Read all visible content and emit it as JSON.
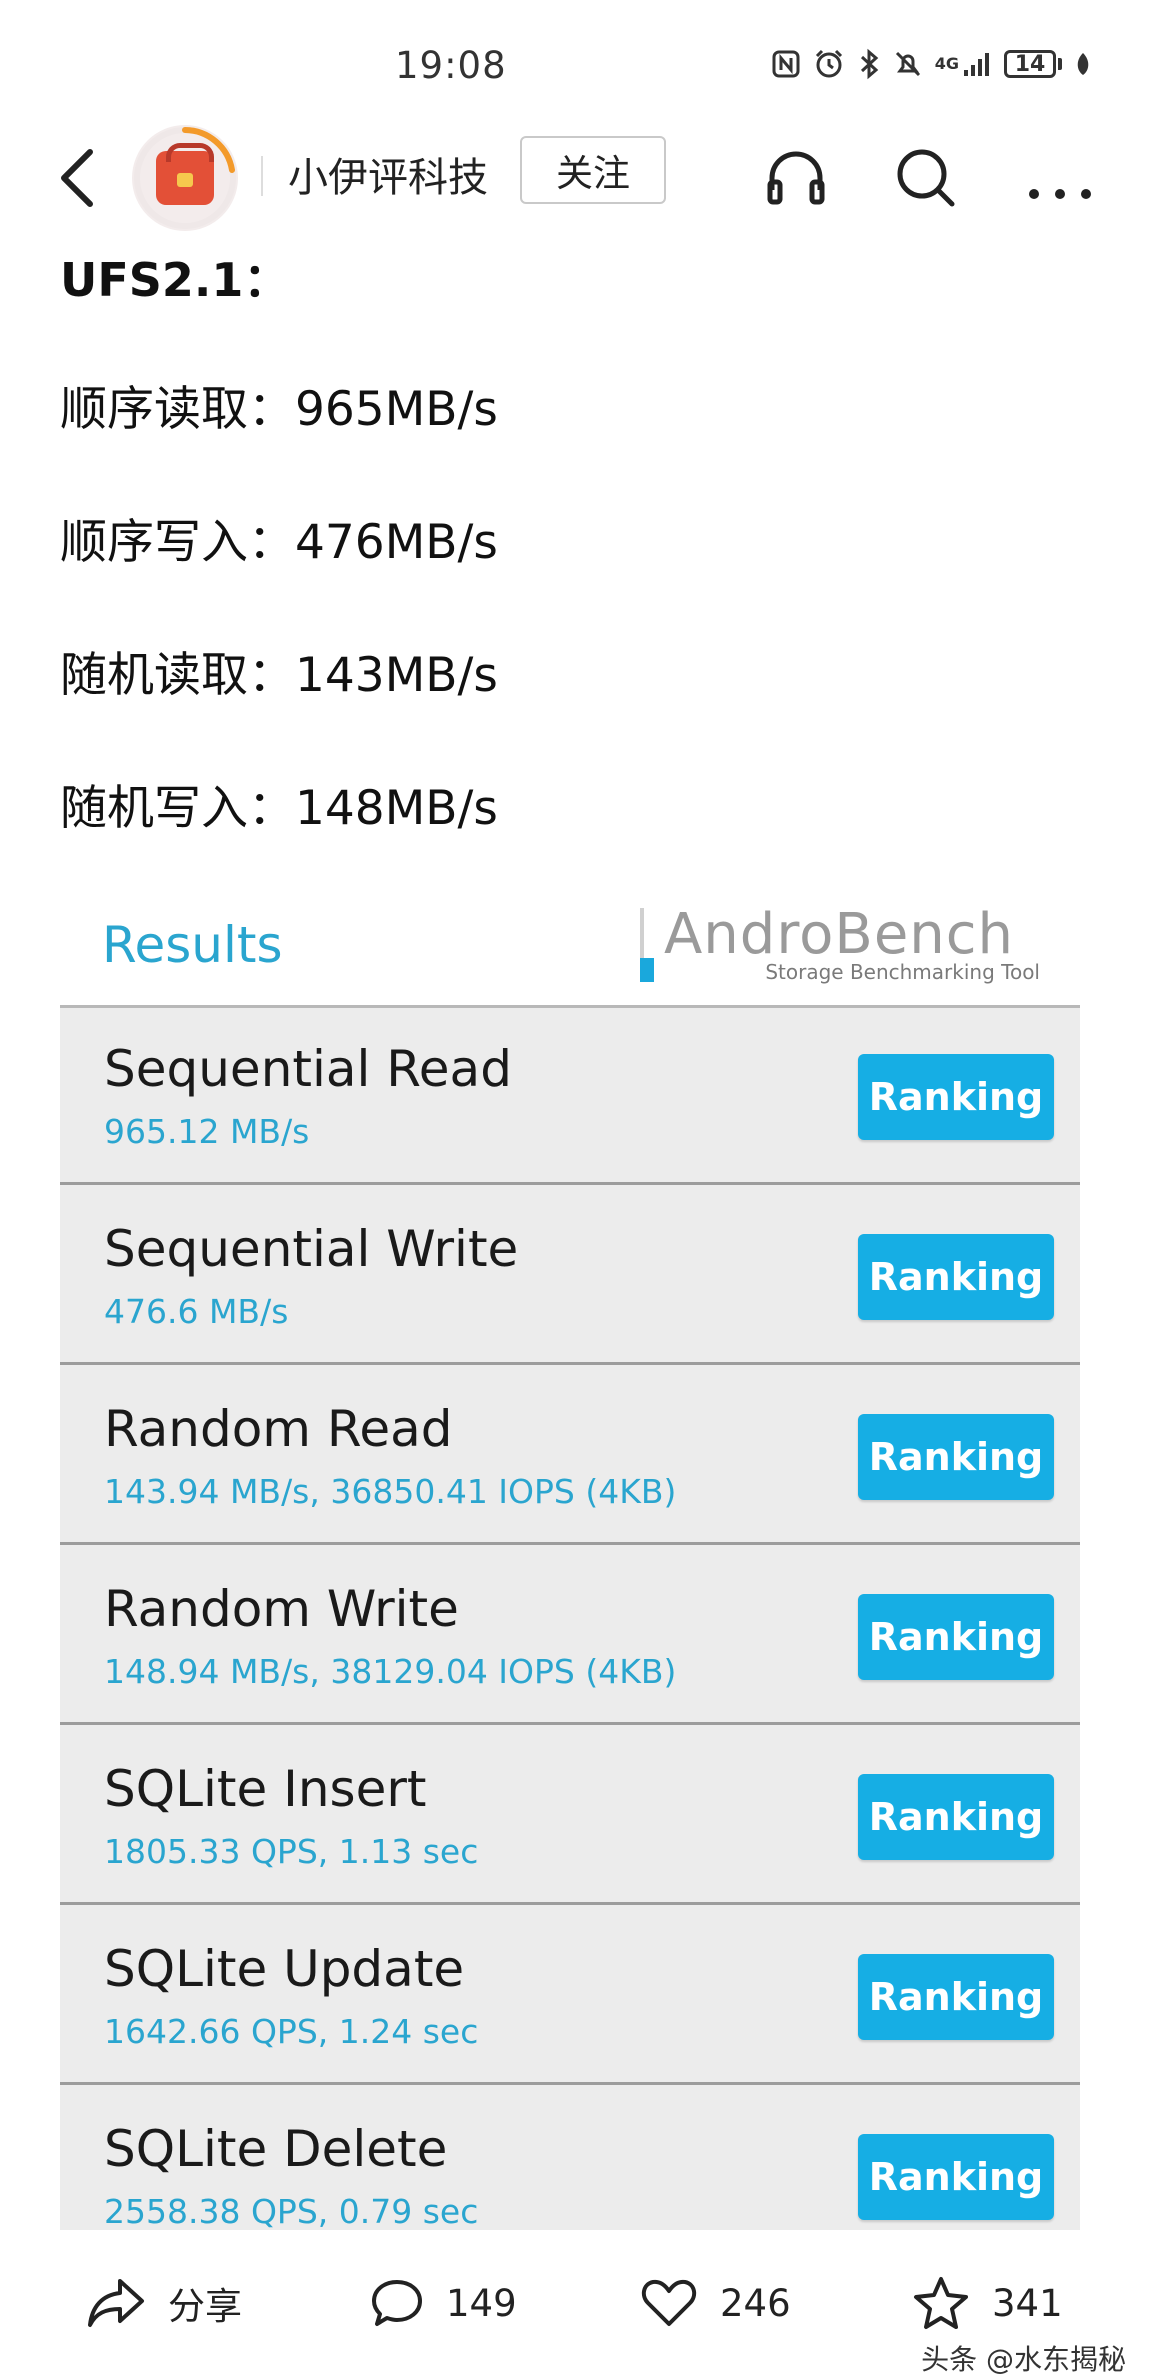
{
  "status_bar": {
    "time": "19:08",
    "icons": [
      "nfc-icon",
      "alarm-icon",
      "bluetooth-icon",
      "mute-icon",
      "signal-4g-icon"
    ],
    "network_label": "4G",
    "battery": "14"
  },
  "nav": {
    "account_name": "小伊评科技",
    "follow_label": "关注"
  },
  "article": {
    "heading": "UFS2.1：",
    "lines": [
      "顺序读取：965MB/s",
      "顺序写入：476MB/s",
      "随机读取：143MB/s",
      "随机写入：148MB/s"
    ]
  },
  "benchmark": {
    "results_label": "Results",
    "logo_title": "AndroBench",
    "logo_subtitle": "Storage Benchmarking Tool",
    "accent_color": "#16aee4",
    "rows": [
      {
        "title": "Sequential Read",
        "value": "965.12 MB/s",
        "button": "Ranking"
      },
      {
        "title": "Sequential Write",
        "value": "476.6 MB/s",
        "button": "Ranking"
      },
      {
        "title": "Random Read",
        "value": "143.94 MB/s, 36850.41 IOPS (4KB)",
        "button": "Ranking"
      },
      {
        "title": "Random Write",
        "value": "148.94 MB/s, 38129.04 IOPS (4KB)",
        "button": "Ranking"
      },
      {
        "title": "SQLite Insert",
        "value": "1805.33 QPS, 1.13 sec",
        "button": "Ranking"
      },
      {
        "title": "SQLite Update",
        "value": "1642.66 QPS, 1.24 sec",
        "button": "Ranking"
      },
      {
        "title": "SQLite Delete",
        "value": "2558.38 QPS, 0.79 sec",
        "button": "Ranking"
      }
    ]
  },
  "bottom_bar": {
    "share_label": "分享",
    "comments": "149",
    "likes": "246",
    "favorites": "341",
    "watermark": "头条 @水东揭秘"
  }
}
